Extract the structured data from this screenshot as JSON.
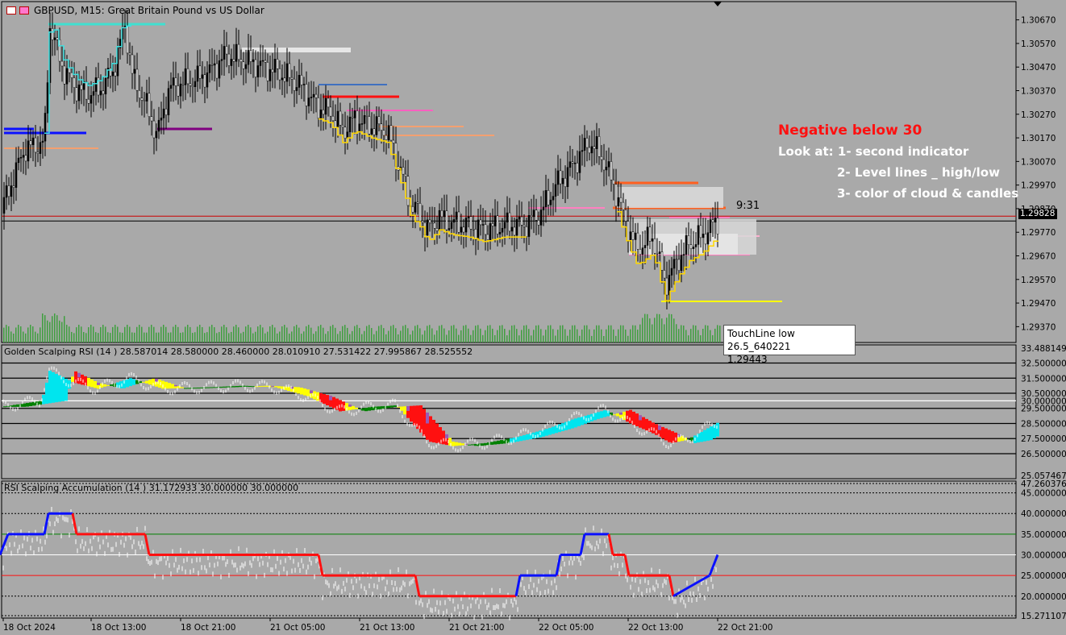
{
  "window": {
    "title": "GBPUSD, M15:  Great Britain Pound vs US Dollar",
    "timer": "9:31",
    "current_price": "1.29828"
  },
  "annotations": {
    "line1": "Negative below 30",
    "line2": "Look at: 1- second indicator",
    "line3": "2- Level lines _ high/low",
    "line4": "3- color of cloud & candles"
  },
  "tooltip": {
    "line1": "TouchLine low 26.5_640221",
    "line2": "1.29443"
  },
  "colors": {
    "background": "#a9a9a9",
    "candle": "#000000",
    "volume": "#3f9f3f",
    "annotation_red": "#ff1010",
    "accum_up": "#0a10ff",
    "accum_down": "#ff1010",
    "rsi_line": "#ffffff"
  },
  "chart_data": [
    {
      "type": "line",
      "name": "price",
      "x": [
        0,
        30,
        55,
        62,
        70,
        80,
        95,
        110,
        125,
        140,
        155,
        165,
        180,
        195,
        210,
        225,
        245,
        260,
        280,
        300,
        320,
        345,
        370,
        395,
        410,
        425,
        440,
        460,
        480,
        500,
        510,
        520,
        530,
        545,
        560,
        580,
        600,
        625,
        650,
        670,
        690,
        710,
        730,
        745,
        760,
        775,
        790,
        810,
        825,
        840,
        855,
        870,
        890
      ],
      "values": [
        1.2985,
        1.3012,
        1.3015,
        1.3065,
        1.3055,
        1.3045,
        1.3038,
        1.3035,
        1.3038,
        1.3045,
        1.3065,
        1.3042,
        1.3032,
        1.3018,
        1.3038,
        1.304,
        1.3042,
        1.3045,
        1.3052,
        1.305,
        1.3048,
        1.3045,
        1.304,
        1.303,
        1.3028,
        1.302,
        1.3025,
        1.3022,
        1.302,
        1.3,
        1.2988,
        1.2985,
        1.2978,
        1.2983,
        1.2981,
        1.298,
        1.2978,
        1.298,
        1.298,
        1.2985,
        1.2997,
        1.3005,
        1.3015,
        1.301,
        1.2998,
        1.2982,
        1.297,
        1.2975,
        1.2955,
        1.2965,
        1.2972,
        1.2975,
        1.2982
      ],
      "xlabels": [
        "18 Oct 2024",
        "18 Oct 13:00",
        "18 Oct 21:00",
        "21 Oct 05:00",
        "21 Oct 13:00",
        "21 Oct 21:00",
        "22 Oct 05:00",
        "22 Oct 13:00",
        "22 Oct 21:00"
      ],
      "yticks": [
        "1.30670",
        "1.30570",
        "1.30470",
        "1.30370",
        "1.30270",
        "1.30170",
        "1.30070",
        "1.29970",
        "1.29870",
        "1.29770",
        "1.29670",
        "1.29570",
        "1.29470",
        "1.29370"
      ],
      "ylim": [
        1.2932,
        1.3072
      ]
    },
    {
      "type": "area",
      "name": "Golden Scalping RSI (14 ) 28.587014 28.580000 28.460000 28.010910 27.531422 27.995867 28.525552",
      "x": [
        0,
        50,
        60,
        90,
        120,
        160,
        200,
        260,
        300,
        340,
        380,
        420,
        460,
        490,
        510,
        530,
        560,
        600,
        640,
        680,
        710,
        750,
        780,
        810,
        830,
        850,
        870,
        890
      ],
      "values": [
        29.6,
        30.0,
        32.0,
        31.2,
        30.8,
        31.5,
        30.8,
        30.9,
        31.0,
        30.9,
        30.3,
        29.3,
        29.6,
        29.7,
        28.5,
        27.3,
        27.0,
        27.2,
        27.6,
        28.2,
        28.8,
        29.4,
        28.5,
        27.8,
        27.2,
        27.4,
        28.0,
        28.6
      ],
      "yticks": [
        "33.488149",
        "32.500000",
        "31.500000",
        "30.500000",
        "30.000000",
        "29.500000",
        "28.500000",
        "27.500000",
        "26.500000",
        "25.057467"
      ],
      "ylim": [
        25.057467,
        33.488149
      ]
    },
    {
      "type": "line",
      "name": "RSI Scalping Accumulation (14 ) 31.172933 30.000000 30.000000",
      "x": [
        0,
        10,
        55,
        60,
        90,
        95,
        180,
        185,
        395,
        400,
        515,
        520,
        640,
        645,
        690,
        695,
        720,
        725,
        755,
        760,
        775,
        780,
        830,
        835,
        880,
        890
      ],
      "values": [
        30,
        35,
        35,
        40,
        40,
        35,
        35,
        30,
        30,
        25,
        25,
        20,
        20,
        25,
        25,
        30,
        30,
        35,
        35,
        30,
        30,
        25,
        25,
        20,
        25,
        30
      ],
      "yticks": [
        "45.000000",
        "40.000000",
        "35.000000",
        "30.000000",
        "25.000000",
        "20.000000",
        "15.271107"
      ],
      "extra_ticks": [
        "47.260376"
      ],
      "ylim": [
        15.271107,
        47.260376
      ]
    }
  ]
}
